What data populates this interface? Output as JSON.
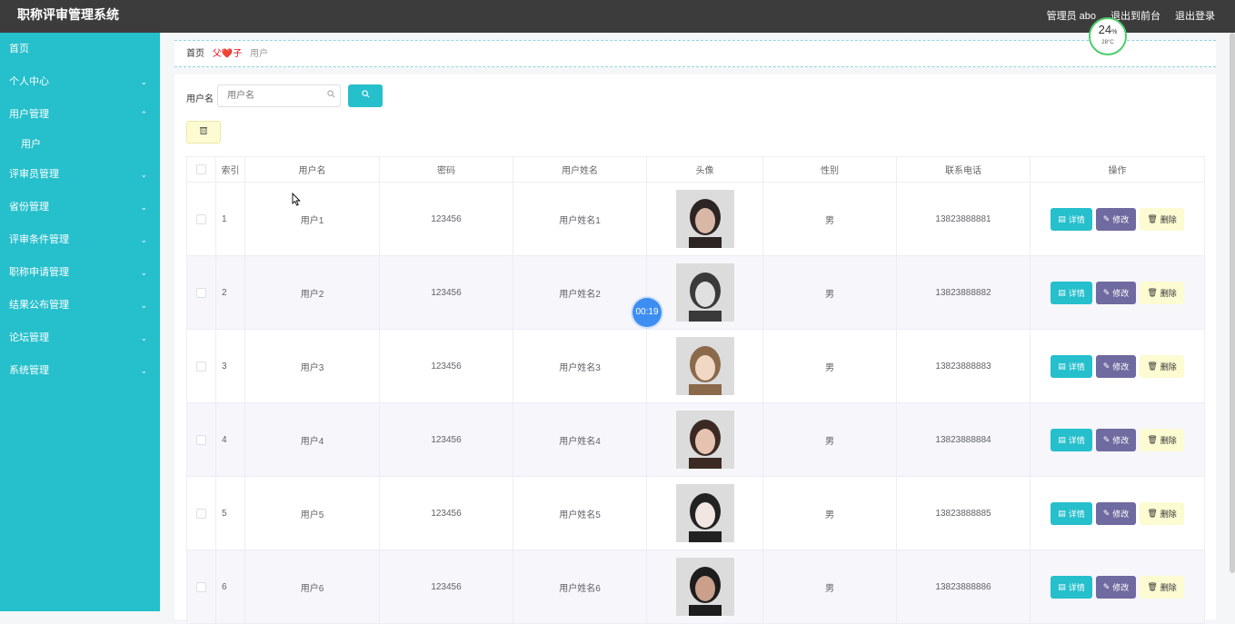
{
  "header": {
    "title": "职称评审管理系统",
    "user": "管理员 abo",
    "to_front": "退出到前台",
    "logout": "退出登录"
  },
  "sidebar": {
    "items": [
      {
        "label": "首页",
        "expandable": false
      },
      {
        "label": "个人中心",
        "expandable": true
      },
      {
        "label": "用户管理",
        "expandable": true,
        "expanded": true
      },
      {
        "label": "用户",
        "sub": true
      },
      {
        "label": "评审员管理",
        "expandable": true
      },
      {
        "label": "省份管理",
        "expandable": true
      },
      {
        "label": "评审条件管理",
        "expandable": true
      },
      {
        "label": "职称申请管理",
        "expandable": true
      },
      {
        "label": "结果公布管理",
        "expandable": true
      },
      {
        "label": "论坛管理",
        "expandable": true
      },
      {
        "label": "系统管理",
        "expandable": true
      }
    ]
  },
  "breadcrumb": {
    "home": "首页",
    "separator": "父❤️子",
    "current": "用户"
  },
  "search": {
    "label": "用户名",
    "placeholder": "用户名"
  },
  "table": {
    "columns": [
      "索引",
      "用户名",
      "密码",
      "用户姓名",
      "头像",
      "性别",
      "联系电话",
      "操作"
    ],
    "rows": [
      {
        "index": "1",
        "username": "用户1",
        "password": "123456",
        "name": "用户姓名1",
        "gender": "男",
        "phone": "13823888881"
      },
      {
        "index": "2",
        "username": "用户2",
        "password": "123456",
        "name": "用户姓名2",
        "gender": "男",
        "phone": "13823888882"
      },
      {
        "index": "3",
        "username": "用户3",
        "password": "123456",
        "name": "用户姓名3",
        "gender": "男",
        "phone": "13823888883"
      },
      {
        "index": "4",
        "username": "用户4",
        "password": "123456",
        "name": "用户姓名4",
        "gender": "男",
        "phone": "13823888884"
      },
      {
        "index": "5",
        "username": "用户5",
        "password": "123456",
        "name": "用户姓名5",
        "gender": "男",
        "phone": "13823888885"
      },
      {
        "index": "6",
        "username": "用户6",
        "password": "123456",
        "name": "用户姓名6",
        "gender": "男",
        "phone": "13823888886"
      }
    ],
    "actions": {
      "detail": "详情",
      "edit": "修改",
      "delete": "删除"
    }
  },
  "overlay": {
    "gauge_value": "24",
    "gauge_unit": "%",
    "gauge_temp": "28°C",
    "timer": "00:19"
  },
  "colors": {
    "sidebar": "#26bfcc",
    "topbar": "#3c3c3c",
    "detail_button": "#26bfcc",
    "edit_button": "#6f6a9f",
    "delete_button": "#fdfbd2"
  }
}
